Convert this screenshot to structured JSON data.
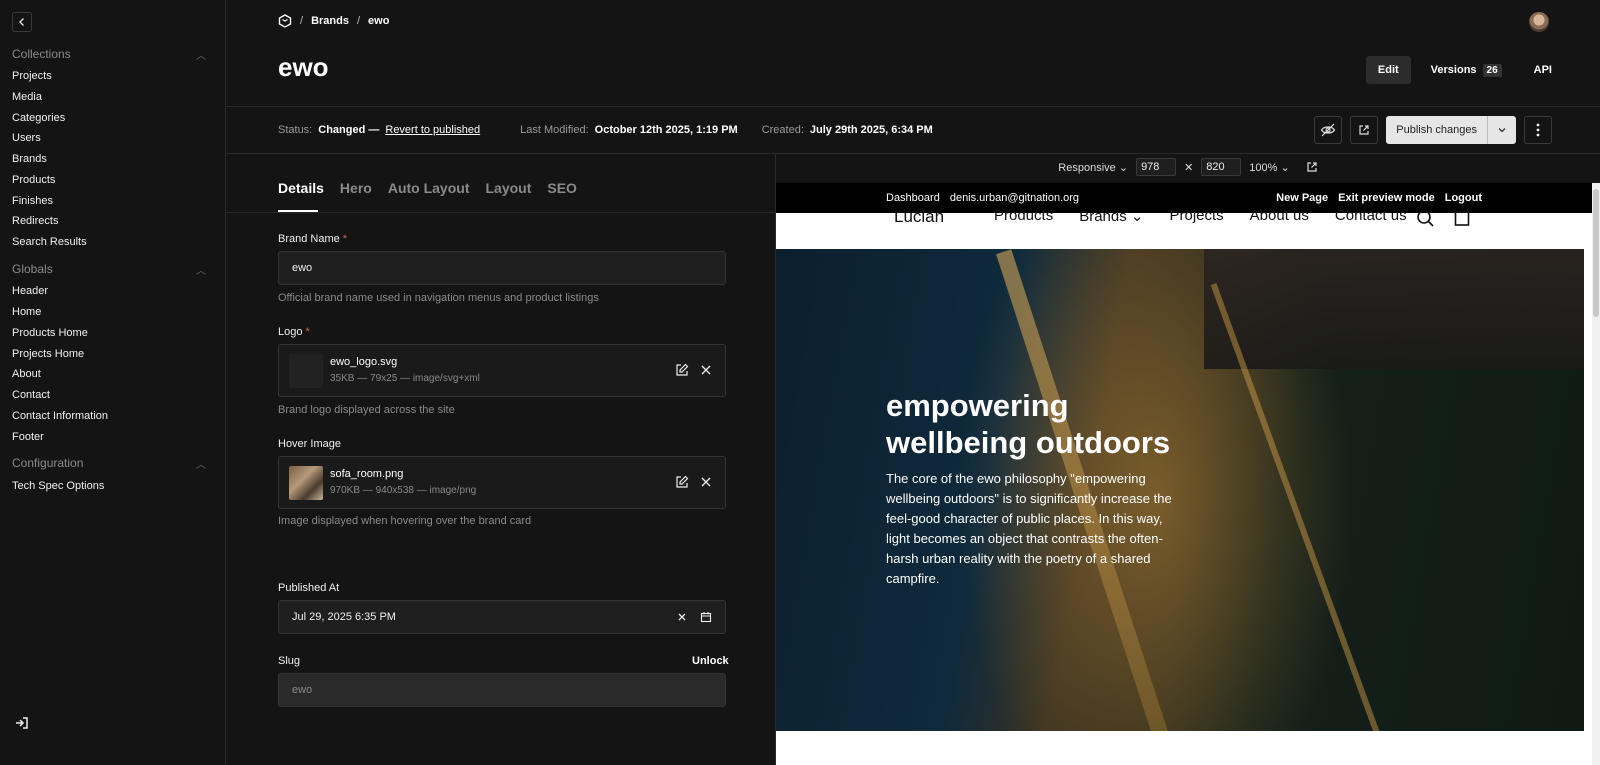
{
  "sidebar": {
    "groups": [
      {
        "title": "Collections",
        "items": [
          "Projects",
          "Media",
          "Categories",
          "Users",
          "Brands",
          "Products",
          "Finishes",
          "Redirects",
          "Search Results"
        ]
      },
      {
        "title": "Globals",
        "items": [
          "Header",
          "Home",
          "Products Home",
          "Projects Home",
          "About",
          "Contact",
          "Contact Information",
          "Footer"
        ]
      },
      {
        "title": "Configuration",
        "items": [
          "Tech Spec Options"
        ]
      }
    ]
  },
  "breadcrumb": {
    "section": "Brands",
    "current": "ewo"
  },
  "page": {
    "title": "ewo"
  },
  "header_actions": {
    "edit": "Edit",
    "versions": "Versions",
    "versions_count": "26",
    "api": "API"
  },
  "status": {
    "status_label": "Status:",
    "status_value": "Changed —",
    "revert": "Revert to published",
    "modified_label": "Last Modified:",
    "modified_value": "October 12th 2025, 1:19 PM",
    "created_label": "Created:",
    "created_value": "July 29th 2025, 6:34 PM",
    "publish": "Publish changes"
  },
  "tabs": [
    "Details",
    "Hero",
    "Auto Layout",
    "Layout",
    "SEO"
  ],
  "form": {
    "brand_name": {
      "label": "Brand Name",
      "value": "ewo",
      "help": "Official brand name used in navigation menus and product listings"
    },
    "logo": {
      "label": "Logo",
      "filename": "ewo_logo.svg",
      "meta": "35KB — 79x25 — image/svg+xml",
      "help": "Brand logo displayed across the site"
    },
    "hover_image": {
      "label": "Hover Image",
      "filename": "sofa_room.png",
      "meta": "970KB — 940x538 — image/png",
      "help": "Image displayed when hovering over the brand card"
    },
    "published_at": {
      "label": "Published At",
      "value": "Jul 29, 2025 6:35 PM"
    },
    "slug": {
      "label": "Slug",
      "value": "ewo",
      "unlock": "Unlock"
    }
  },
  "preview": {
    "mode": "Responsive",
    "width": "978",
    "height": "820",
    "zoom": "100%",
    "admin_bar": {
      "dashboard": "Dashboard",
      "email": "denis.urban@gitnation.org",
      "new_page": "New Page",
      "exit": "Exit preview mode",
      "logout": "Logout"
    },
    "site_nav": {
      "logo": "Lucian",
      "links": [
        "Products",
        "Brands",
        "Projects",
        "About us",
        "Contact us"
      ]
    },
    "hero": {
      "title": "empowering wellbeing outdoors",
      "body": "The core of the ewo philosophy \"empowering wellbeing outdoors\" is to significantly increase the feel-good character of public places. In this way, light becomes an object that contrasts the often-harsh urban reality with the poetry of a shared campfire."
    }
  }
}
